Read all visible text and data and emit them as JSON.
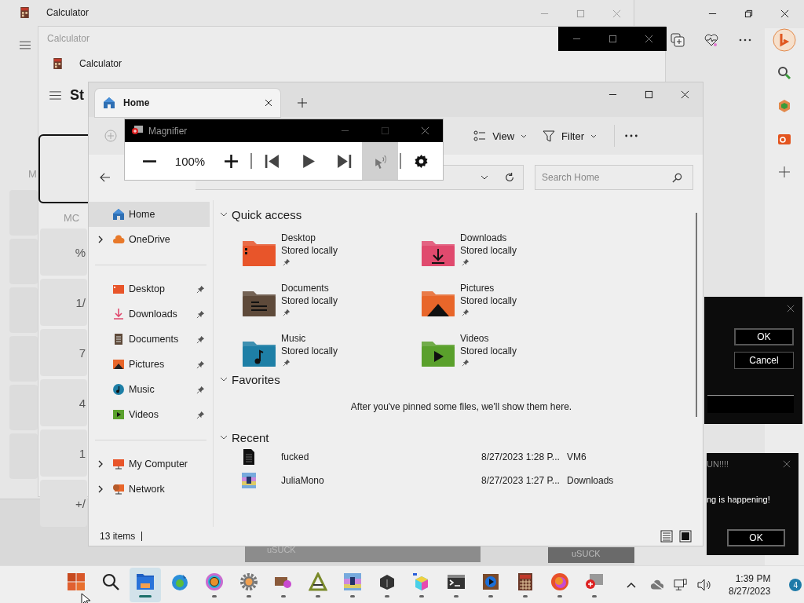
{
  "background_window": {
    "title": "Calculator"
  },
  "calculator": {
    "window_title": "Calculator",
    "app_title": "Calculator",
    "mode_title": "St",
    "memory_label": "M",
    "memory_button": "MC",
    "keys": [
      "%",
      "1/",
      "7",
      "4",
      "1",
      "+/"
    ]
  },
  "explorer": {
    "tabs": [
      {
        "label": "Home",
        "selected": true
      }
    ],
    "toolbar": [
      {
        "label": "View",
        "kind": "view"
      },
      {
        "label": "Filter",
        "kind": "filter"
      }
    ],
    "search": {
      "placeholder": "Search Home"
    },
    "sidebar": {
      "groups": [
        [
          {
            "label": "Home",
            "kind": "home",
            "selected": true,
            "expandable": false,
            "pinned": false
          },
          {
            "label": "OneDrive",
            "kind": "cloud",
            "selected": false,
            "expandable": true,
            "pinned": false
          }
        ],
        [
          {
            "label": "Desktop",
            "kind": "desktop",
            "selected": false,
            "expandable": false,
            "pinned": true
          },
          {
            "label": "Downloads",
            "kind": "downloads",
            "selected": false,
            "expandable": false,
            "pinned": true
          },
          {
            "label": "Documents",
            "kind": "documents",
            "selected": false,
            "expandable": false,
            "pinned": true
          },
          {
            "label": "Pictures",
            "kind": "pictures",
            "selected": false,
            "expandable": false,
            "pinned": true
          },
          {
            "label": "Music",
            "kind": "music",
            "selected": false,
            "expandable": false,
            "pinned": true
          },
          {
            "label": "Videos",
            "kind": "videos",
            "selected": false,
            "expandable": false,
            "pinned": true
          }
        ],
        [
          {
            "label": "My Computer",
            "kind": "computer",
            "selected": false,
            "expandable": true,
            "pinned": false
          },
          {
            "label": "Network",
            "kind": "network",
            "selected": false,
            "expandable": true,
            "pinned": false
          }
        ]
      ]
    },
    "quick_access": {
      "title": "Quick access",
      "expanded": true,
      "items": [
        {
          "name": "Desktop",
          "status": "Stored locally",
          "kind": "desktop",
          "pinned": true
        },
        {
          "name": "Downloads",
          "status": "Stored locally",
          "kind": "downloads",
          "pinned": true
        },
        {
          "name": "Documents",
          "status": "Stored locally",
          "kind": "documents",
          "pinned": true
        },
        {
          "name": "Pictures",
          "status": "Stored locally",
          "kind": "pictures",
          "pinned": true
        },
        {
          "name": "Music",
          "status": "Stored locally",
          "kind": "music",
          "pinned": true
        },
        {
          "name": "Videos",
          "status": "Stored locally",
          "kind": "videos",
          "pinned": true
        }
      ]
    },
    "favorites": {
      "title": "Favorites",
      "expanded": true,
      "empty_message": "After you've pinned some files, we'll show them here."
    },
    "recent": {
      "title": "Recent",
      "expanded": true,
      "rows": [
        {
          "name": "fucked",
          "modified": "8/27/2023 1:28 P...",
          "location": "VM6",
          "kind": "document"
        },
        {
          "name": "JuliaMono",
          "modified": "8/27/2023 1:27 P...",
          "location": "Downloads",
          "kind": "archive"
        }
      ]
    },
    "status_bar": {
      "item_count": "13 items"
    }
  },
  "magnifier": {
    "title": "Magnifier",
    "zoom": "100%"
  },
  "dialog_1": {
    "buttons": [
      "OK",
      "Cancel"
    ]
  },
  "dialog_2": {
    "title": "UN!!!!",
    "message": "ng is happening!",
    "buttons": [
      "OK"
    ]
  },
  "taskbar_previews": [
    "uSUCK",
    "uSUCK"
  ],
  "taskbar": {
    "apps": [
      {
        "kind": "grid",
        "selected": false,
        "running": false
      },
      {
        "kind": "search",
        "selected": false,
        "running": false
      },
      {
        "kind": "folder",
        "selected": true,
        "running": true
      },
      {
        "kind": "globe",
        "selected": false,
        "running": false
      },
      {
        "kind": "ring",
        "selected": false,
        "running": true
      },
      {
        "kind": "gear",
        "selected": false,
        "running": true
      },
      {
        "kind": "card",
        "selected": false,
        "running": true
      },
      {
        "kind": "triangle",
        "selected": false,
        "running": true
      },
      {
        "kind": "tiles",
        "selected": false,
        "running": true
      },
      {
        "kind": "box",
        "selected": false,
        "running": true
      },
      {
        "kind": "cube",
        "selected": false,
        "running": true
      },
      {
        "kind": "terminal",
        "selected": false,
        "running": true
      },
      {
        "kind": "player",
        "selected": false,
        "running": true
      },
      {
        "kind": "calculator",
        "selected": false,
        "running": true
      },
      {
        "kind": "swirl",
        "selected": false,
        "running": true
      },
      {
        "kind": "magnifier",
        "selected": false,
        "running": true
      }
    ],
    "clock": {
      "time": "1:39 PM",
      "date": "8/27/2023"
    },
    "notification_count": "4"
  }
}
